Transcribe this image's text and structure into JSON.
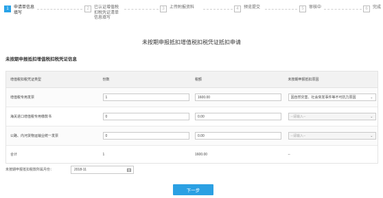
{
  "steps": [
    {
      "num": "1",
      "label": "申请单信息填写",
      "active": true
    },
    {
      "num": "2",
      "label": "已认证增值税扣税凭证清单信息填写",
      "active": false
    },
    {
      "num": "3",
      "label": "上传附报资料",
      "active": false
    },
    {
      "num": "4",
      "label": "预览提交",
      "active": false
    },
    {
      "num": "5",
      "label": "审核中",
      "active": false
    },
    {
      "num": "6",
      "label": "完成",
      "active": false
    }
  ],
  "page_title": "未按期申报抵扣增值税扣税凭证抵扣申请",
  "section_title": "未按期申报抵扣增值税扣税凭证信息",
  "table": {
    "headers": [
      "增值税扣税凭证类型",
      "份数",
      "税额",
      "未按期申报抵扣原因"
    ],
    "rows": [
      {
        "type": "增值税专用发票",
        "count": "1",
        "tax": "1600.00",
        "reason": "因自然灾害、社会突发事件等不可抗力原因",
        "reason_disabled": false
      },
      {
        "type": "海关进口增值税专用缴款书",
        "count": "0",
        "tax": "0.00",
        "reason": "--请输入--",
        "reason_disabled": true
      },
      {
        "type": "公路、内河货物运输业统一发票",
        "count": "0",
        "tax": "0.00",
        "reason": "--请输入--",
        "reason_disabled": true
      }
    ],
    "total": {
      "label": "合计",
      "count": "1",
      "tax": "1600.00",
      "reason": "--"
    }
  },
  "period": {
    "label": "未按期申报抵扣税款所属月份：",
    "value": "2018-11"
  },
  "next_button": "下一步",
  "colors": {
    "accent": "#29a3e8",
    "header_bg": "#f2f2f2",
    "border": "#e3e3e3"
  }
}
